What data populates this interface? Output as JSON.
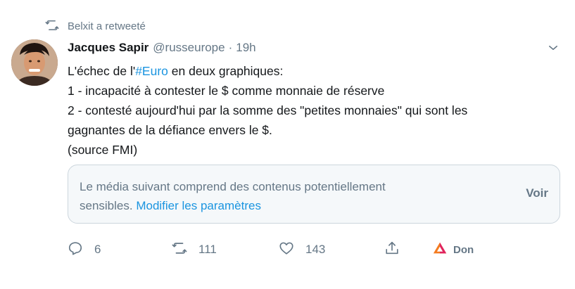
{
  "retweet": {
    "label": "Belxit a retweeté"
  },
  "tweet": {
    "author_name": "Jacques Sapir",
    "author_handle": "@russeurope",
    "separator": "·",
    "time": "19h",
    "text": {
      "line1_prefix": "L'échec de l'",
      "line1_hashtag": "#Euro",
      "line1_suffix": " en deux graphiques:",
      "line2": "1 - incapacité à contester le $ comme monnaie de réserve",
      "line3": "2 - contesté aujourd'hui par la somme des \"petites monnaies\" qui sont les",
      "line4": "gagnantes de la défiance envers le $.",
      "line5": "(source FMI)"
    }
  },
  "media_warning": {
    "message_line1": "Le média suivant comprend des contenus potentiellement",
    "message_line2": "sensibles. ",
    "settings_link": "Modifier les paramètres",
    "view_button": "Voir"
  },
  "actions": {
    "reply_count": "6",
    "retweet_count": "111",
    "like_count": "143",
    "don_label": "Don"
  },
  "colors": {
    "link": "#1b95e0",
    "muted": "#657786",
    "don_accent": "#e0245e"
  },
  "icons": {
    "retweet": "retweet-icon",
    "caret": "chevron-down-icon",
    "reply": "reply-icon",
    "like": "heart-icon",
    "share": "share-icon",
    "don": "brave-triangle-icon"
  }
}
